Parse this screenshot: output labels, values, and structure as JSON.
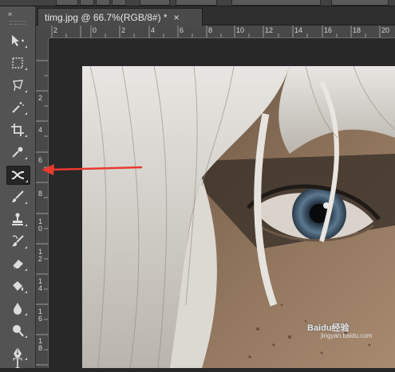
{
  "document": {
    "tab_title": "timg.jpg @ 66.7%(RGB/8#) *",
    "close_glyph": "×"
  },
  "tools_panel": {
    "collapse_glyph": "»",
    "tools": [
      {
        "icon": "move-tool-icon"
      },
      {
        "icon": "rectangular-marquee-icon"
      },
      {
        "icon": "lasso-icon"
      },
      {
        "icon": "magic-wand-icon"
      },
      {
        "icon": "crop-icon"
      },
      {
        "icon": "eyedropper-icon"
      },
      {
        "icon": "spot-healing-brush-icon",
        "active": true
      },
      {
        "icon": "brush-icon"
      },
      {
        "icon": "clone-stamp-icon"
      },
      {
        "icon": "history-brush-icon"
      },
      {
        "icon": "eraser-icon"
      },
      {
        "icon": "paint-bucket-icon"
      },
      {
        "icon": "blur-icon"
      },
      {
        "icon": "dodge-icon"
      },
      {
        "icon": "pen-icon"
      },
      {
        "icon": "type-icon",
        "label": "T"
      }
    ]
  },
  "rulers": {
    "horizontal": [
      "2",
      "0",
      "2",
      "4",
      "6",
      "8",
      "10",
      "12",
      "14",
      "16",
      "18",
      "20"
    ],
    "vertical": [
      "2",
      "4",
      "6",
      "8",
      "1 0",
      "1 2",
      "1 4",
      "1 6",
      "1 8"
    ]
  },
  "watermark": {
    "brand": "Baidu经验",
    "site": "jingyan.baidu.com"
  },
  "colors": {
    "annotation_arrow": "#e8392f",
    "panel_bg": "#535353",
    "canvas_bg": "#282828"
  }
}
